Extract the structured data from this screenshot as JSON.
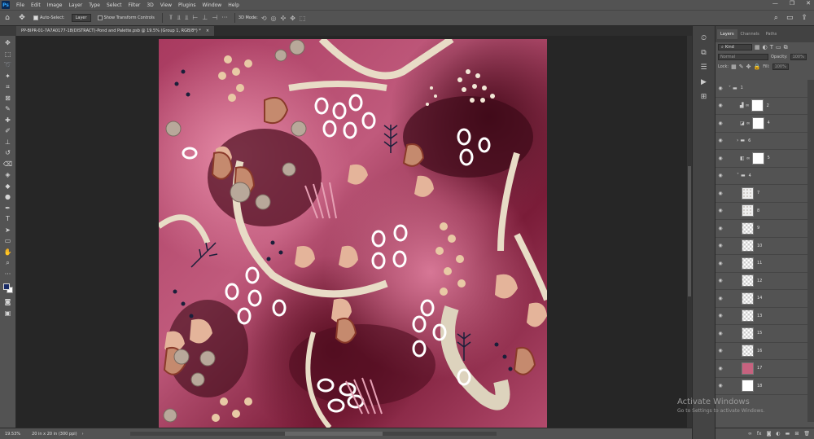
{
  "menubar": {
    "logo": "Ps",
    "items": [
      "File",
      "Edit",
      "Image",
      "Layer",
      "Type",
      "Select",
      "Filter",
      "3D",
      "View",
      "Plugins",
      "Window",
      "Help"
    ],
    "right_icons": [
      "search-icon",
      "workspace-icon",
      "share-icon"
    ]
  },
  "options": {
    "auto_select_label": "Auto-Select:",
    "auto_select_value": "Layer",
    "transform_label": "Show Transform Controls",
    "mode_3d": "3D Mode:"
  },
  "document": {
    "tab_title": "PP-BIPR-01-7A7A0177-18(DISTRACT)-Pond and Palette.psb @ 19.5% (Group 1, RGB/8*) *",
    "close": "×"
  },
  "status": {
    "zoom": "19.53%",
    "doc_info": "20 in x 20 in (300 ppi)",
    "more": "›"
  },
  "layers_panel": {
    "tabs": [
      "Layers",
      "Channels",
      "Paths"
    ],
    "kind_label": "Kind",
    "blend_mode": "Normal",
    "opacity_label": "Opacity:",
    "opacity_value": "100%",
    "lock_label": "Lock:",
    "fill_label": "Fill:",
    "fill_value": "100%",
    "layers": [
      {
        "name": "1",
        "type": "group",
        "indent": 0
      },
      {
        "name": "2",
        "type": "adjust",
        "indent": 1
      },
      {
        "name": "4",
        "type": "adjust",
        "indent": 1
      },
      {
        "name": "6",
        "type": "group",
        "indent": 1
      },
      {
        "name": "5",
        "type": "adjust",
        "indent": 1
      },
      {
        "name": "4",
        "type": "group",
        "indent": 1
      },
      {
        "name": "7",
        "type": "texture",
        "indent": 2
      },
      {
        "name": "8",
        "type": "texture",
        "indent": 2
      },
      {
        "name": "9",
        "type": "check",
        "indent": 2
      },
      {
        "name": "10",
        "type": "check",
        "indent": 2
      },
      {
        "name": "11",
        "type": "check",
        "indent": 2
      },
      {
        "name": "12",
        "type": "check",
        "indent": 2
      },
      {
        "name": "14",
        "type": "check",
        "indent": 2
      },
      {
        "name": "13",
        "type": "check",
        "indent": 2
      },
      {
        "name": "15",
        "type": "check",
        "indent": 2
      },
      {
        "name": "16",
        "type": "check",
        "indent": 2
      },
      {
        "name": "17",
        "type": "pink",
        "indent": 2
      },
      {
        "name": "18",
        "type": "white",
        "indent": 2
      }
    ]
  },
  "watermark": {
    "line1": "Activate Windows",
    "line2": "Go to Settings to activate Windows."
  }
}
